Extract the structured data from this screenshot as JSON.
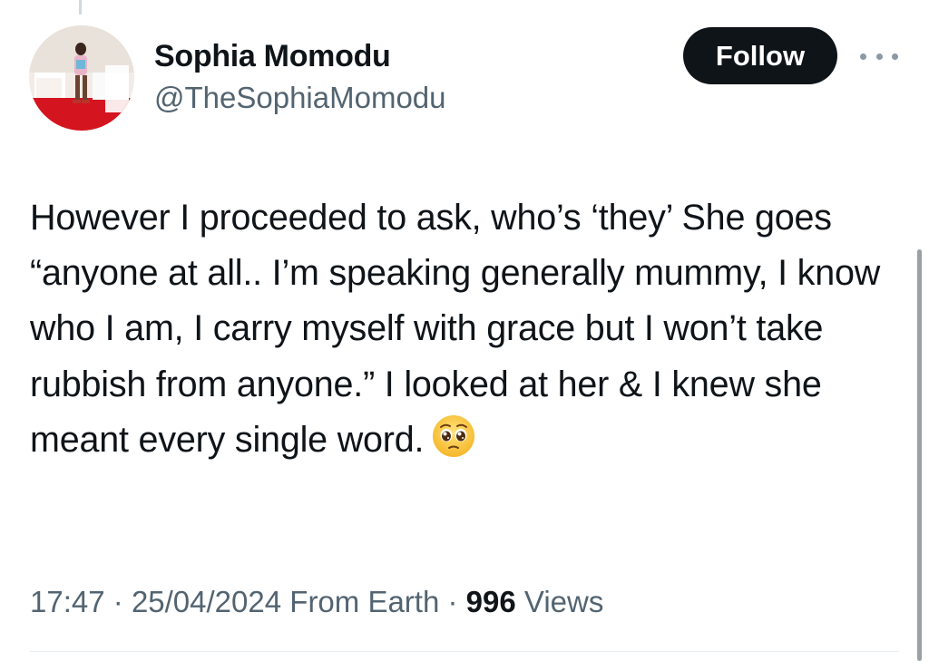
{
  "author": {
    "display_name": "Sophia Momodu",
    "handle": "@TheSophiaMomodu"
  },
  "actions": {
    "follow_label": "Follow",
    "more_icon": "more-horizontal-icon"
  },
  "tweet": {
    "text": "However I proceeded to ask, who’s ‘they’ She goes “anyone at all.. I’m speaking generally mummy, I know who I am, I carry myself with grace but I won’t take rubbish from anyone.” I looked at her & I knew she meant every single word.",
    "emoji": "pleading-face-emoji"
  },
  "meta": {
    "time": "17:47",
    "separator": "·",
    "date": "25/04/2024",
    "source": "From Earth",
    "views_count": "996",
    "views_label": "Views"
  },
  "colors": {
    "primary_text": "#0f1419",
    "secondary_text": "#536471",
    "button_bg": "#0f1419",
    "button_text": "#ffffff"
  }
}
